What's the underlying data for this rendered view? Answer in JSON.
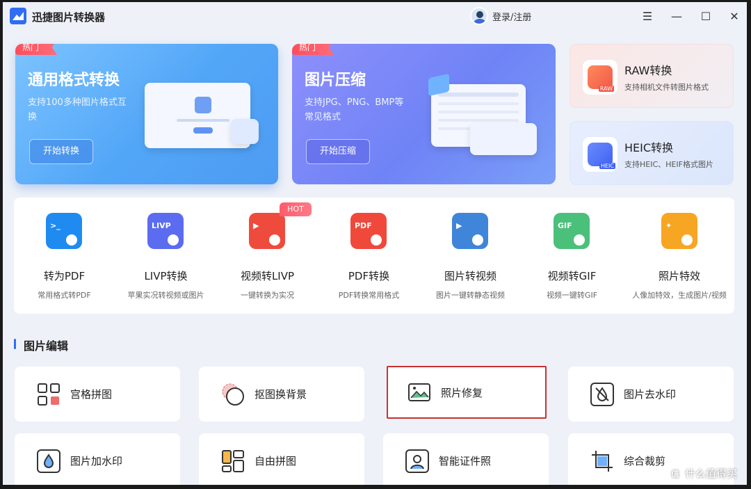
{
  "app": {
    "title": "迅捷图片转换器",
    "login": "登录/注册"
  },
  "window_controls": {
    "menu": "☰",
    "minimize": "—",
    "maximize": "☐",
    "close": "✕"
  },
  "hero": [
    {
      "badge": "热门",
      "title": "通用格式转换",
      "desc": "支持100多种图片格式互换",
      "button": "开始转换"
    },
    {
      "badge": "热门",
      "title": "图片压缩",
      "desc": "支持JPG、PNG、BMP等常见格式",
      "button": "开始压缩"
    }
  ],
  "side_cards": [
    {
      "title": "RAW转换",
      "desc": "支持相机文件转图片格式",
      "icon": "raw-camera-icon",
      "tag": "RAW"
    },
    {
      "title": "HEIC转换",
      "desc": "支持HEIC、HEIF格式图片",
      "icon": "heic-image-icon",
      "tag": "HEIC"
    }
  ],
  "hot_label": "HOT",
  "tools": [
    {
      "name": "转为PDF",
      "desc": "常用格式转PDF",
      "icon": "to-pdf-icon",
      "color": "#1f8bf0",
      "glyph": ">_"
    },
    {
      "name": "LIVP转换",
      "desc": "苹果实况转视频或图片",
      "icon": "livp-icon",
      "color": "#5b6cf0",
      "glyph": "LIVP"
    },
    {
      "name": "视频转LIVP",
      "desc": "一键转换为实况",
      "icon": "video-to-livp-icon",
      "color": "#ef4b3d",
      "glyph": "▶"
    },
    {
      "name": "PDF转换",
      "desc": "PDF转换常用格式",
      "icon": "pdf-convert-icon",
      "color": "#f0493c",
      "glyph": "PDF"
    },
    {
      "name": "图片转视频",
      "desc": "图片一键转静态视频",
      "icon": "image-to-video-icon",
      "color": "#3f85d9",
      "glyph": "▶"
    },
    {
      "name": "视频转GIF",
      "desc": "视频一键转GIF",
      "icon": "video-to-gif-icon",
      "color": "#4bc07a",
      "glyph": "GIF"
    },
    {
      "name": "照片特效",
      "desc": "人像加特效，生成图片/视频",
      "icon": "photo-effect-icon",
      "color": "#f6a623",
      "glyph": "✦"
    }
  ],
  "section": {
    "title": "图片编辑"
  },
  "edit_tools": [
    {
      "label": "宫格拼图",
      "icon": "grid-collage-icon"
    },
    {
      "label": "抠图换背景",
      "icon": "cutout-background-icon"
    },
    {
      "label": "照片修复",
      "icon": "photo-repair-icon"
    },
    {
      "label": "图片去水印",
      "icon": "remove-watermark-icon"
    },
    {
      "label": "图片加水印",
      "icon": "add-watermark-icon"
    },
    {
      "label": "自由拼图",
      "icon": "free-collage-icon"
    },
    {
      "label": "智能证件照",
      "icon": "id-photo-icon"
    },
    {
      "label": "综合裁剪",
      "icon": "crop-icon"
    }
  ],
  "watermark": {
    "text": "什么值得买",
    "glyph": "值"
  }
}
